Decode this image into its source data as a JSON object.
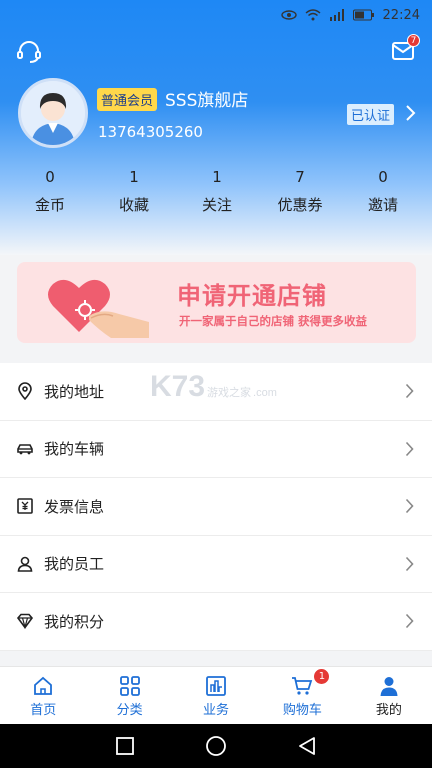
{
  "status_bar": {
    "time": "22:24"
  },
  "header": {
    "mail_badge": "7",
    "member_badge": "普通会员",
    "shop_name": "SSS旗舰店",
    "phone": "13764305260",
    "verified": "已认证"
  },
  "stats": [
    {
      "value": "0",
      "label": "金币"
    },
    {
      "value": "1",
      "label": "收藏"
    },
    {
      "value": "1",
      "label": "关注"
    },
    {
      "value": "7",
      "label": "优惠券"
    },
    {
      "value": "0",
      "label": "邀请"
    }
  ],
  "banner": {
    "title": "申请开通店铺",
    "subtitle": "开一家属于自己的店铺  获得更多收益"
  },
  "menu": [
    {
      "label": "我的地址",
      "icon": "location-icon"
    },
    {
      "label": "我的车辆",
      "icon": "car-icon"
    },
    {
      "label": "发票信息",
      "icon": "invoice-icon"
    },
    {
      "label": "我的员工",
      "icon": "employee-icon"
    },
    {
      "label": "我的积分",
      "icon": "diamond-icon"
    }
  ],
  "tabbar": [
    {
      "label": "首页",
      "icon": "home-icon"
    },
    {
      "label": "分类",
      "icon": "grid-icon"
    },
    {
      "label": "业务",
      "icon": "business-icon"
    },
    {
      "label": "购物车",
      "icon": "cart-icon",
      "badge": "1"
    },
    {
      "label": "我的",
      "icon": "user-icon",
      "active": true
    }
  ],
  "watermark": {
    "text": "K73",
    "sub1": "游戏之家",
    "sub2": ".com"
  },
  "colors": {
    "primary": "#1e88f5",
    "banner_text": "#f06476",
    "badge": "#e53935"
  }
}
